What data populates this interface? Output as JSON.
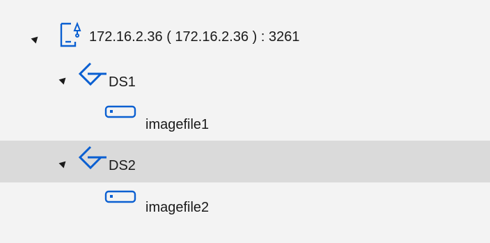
{
  "tree": {
    "server": {
      "label": "172.16.2.36 ( 172.16.2.36 ) : 3261",
      "icon": "server-icon",
      "expanded": true
    },
    "datastores": [
      {
        "label": "DS1",
        "icon": "datastore-icon",
        "expanded": true,
        "selected": false,
        "children": [
          {
            "label": "imagefile1",
            "icon": "disk-icon"
          }
        ]
      },
      {
        "label": "DS2",
        "icon": "datastore-icon",
        "expanded": true,
        "selected": true,
        "children": [
          {
            "label": "imagefile2",
            "icon": "disk-icon"
          }
        ]
      }
    ]
  },
  "colors": {
    "accent": "#0a5fd1",
    "selected_row": "#dadada",
    "background": "#f3f3f3",
    "text": "#1a1a1a"
  }
}
